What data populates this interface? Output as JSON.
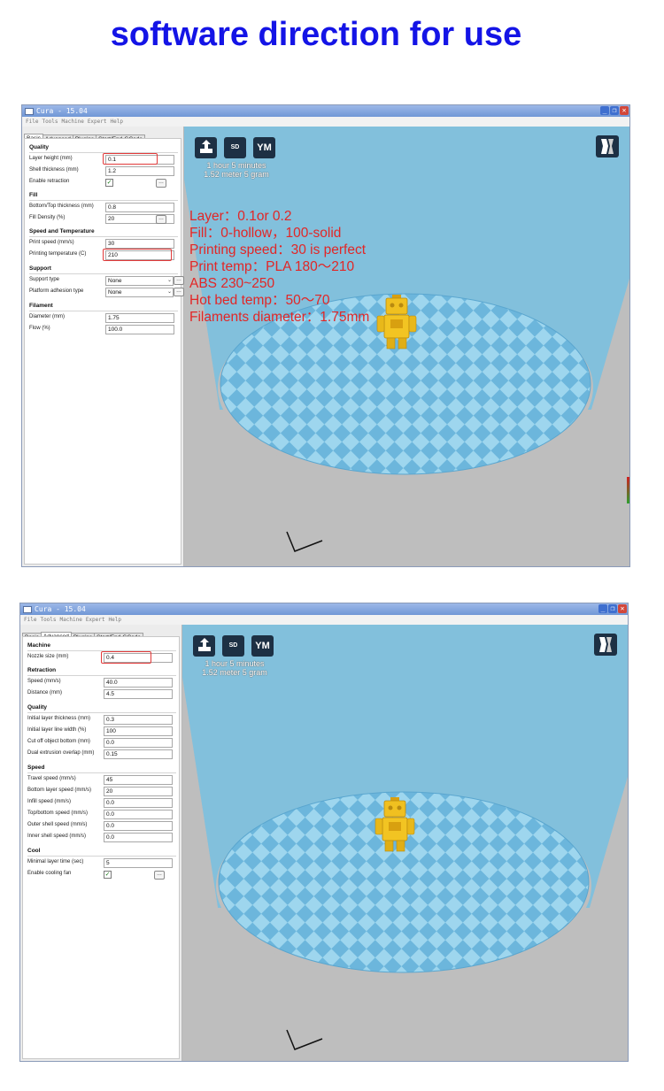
{
  "page_title": "software direction for use",
  "window_title": "Cura - 15.04",
  "menu": [
    "File",
    "Tools",
    "Machine",
    "Expert",
    "Help"
  ],
  "tabs": [
    "Basic",
    "Advanced",
    "Plugins",
    "Start/End-GCode"
  ],
  "print_info": {
    "time": "1 hour 5 minutes",
    "material": "1.52 meter 5 gram"
  },
  "toolbar": {
    "sd_label": "SD",
    "ym_label": "YM"
  },
  "basic": {
    "active_tab": "Basic",
    "sections": {
      "quality": "Quality",
      "fill": "Fill",
      "speed_temp": "Speed and Temperature",
      "support": "Support",
      "filament": "Filament"
    },
    "fields": {
      "layer_height": {
        "label": "Layer height (mm)",
        "value": "0.1"
      },
      "shell_thickness": {
        "label": "Shell thickness (mm)",
        "value": "1.2"
      },
      "enable_retraction": {
        "label": "Enable retraction",
        "checked": true
      },
      "bottom_top_thickness": {
        "label": "Bottom/Top thickness (mm)",
        "value": "0.8"
      },
      "fill_density": {
        "label": "Fill Density (%)",
        "value": "20"
      },
      "print_speed": {
        "label": "Print speed (mm/s)",
        "value": "30"
      },
      "printing_temperature": {
        "label": "Printing temperature (C)",
        "value": "210"
      },
      "support_type": {
        "label": "Support type",
        "value": "None"
      },
      "platform_adhesion": {
        "label": "Platform adhesion type",
        "value": "None"
      },
      "diameter": {
        "label": "Diameter (mm)",
        "value": "1.75"
      },
      "flow": {
        "label": "Flow (%)",
        "value": "100.0"
      }
    }
  },
  "annotation": {
    "layer": "Layer：0.1or 0.2",
    "fill": "Fill：0-hollow，100-solid",
    "speed": "Printing speed：30 is perfect",
    "temp_pla": "Print temp：PLA 180～210",
    "temp_abs": "ABS 230~250",
    "bed": "Hot bed temp：50～70",
    "filament": "Filaments diameter：1.75mm"
  },
  "advanced": {
    "active_tab": "Advanced",
    "sections": {
      "machine": "Machine",
      "retraction": "Retraction",
      "quality": "Quality",
      "speed": "Speed",
      "cool": "Cool"
    },
    "fields": {
      "nozzle_size": {
        "label": "Nozzle size (mm)",
        "value": "0.4"
      },
      "retraction_speed": {
        "label": "Speed (mm/s)",
        "value": "40.0"
      },
      "retraction_distance": {
        "label": "Distance (mm)",
        "value": "4.5"
      },
      "initial_layer_thickness": {
        "label": "Initial layer thickness (mm)",
        "value": "0.3"
      },
      "initial_layer_line_width": {
        "label": "Initial layer line width (%)",
        "value": "100"
      },
      "cut_off_bottom": {
        "label": "Cut off object bottom (mm)",
        "value": "0.0"
      },
      "dual_extrusion_overlap": {
        "label": "Dual extrusion overlap (mm)",
        "value": "0.15"
      },
      "travel_speed": {
        "label": "Travel speed (mm/s)",
        "value": "45"
      },
      "bottom_layer_speed": {
        "label": "Bottom layer speed (mm/s)",
        "value": "20"
      },
      "infill_speed": {
        "label": "Infill speed (mm/s)",
        "value": "0.0"
      },
      "top_bottom_speed": {
        "label": "Top/bottom speed (mm/s)",
        "value": "0.0"
      },
      "outer_shell_speed": {
        "label": "Outer shell speed (mm/s)",
        "value": "0.0"
      },
      "inner_shell_speed": {
        "label": "Inner shell speed (mm/s)",
        "value": "0.0"
      },
      "minimal_layer_time": {
        "label": "Minimal layer time (sec)",
        "value": "5"
      },
      "enable_cooling_fan": {
        "label": "Enable cooling fan",
        "checked": true
      }
    }
  },
  "colors": {
    "title_blue": "#1414e6",
    "annotation_red": "#e22626",
    "build_volume": "#82c0dc",
    "bed_light": "#9ed6ee",
    "bed_dark": "#66b3d9",
    "model_yellow": "#f0c020",
    "toolbar_button": "#1d3044"
  },
  "icons": [
    "load-model-icon",
    "sd-card-icon",
    "youmagine-icon",
    "view-mode-icon",
    "axis-icon",
    "robot-model"
  ]
}
